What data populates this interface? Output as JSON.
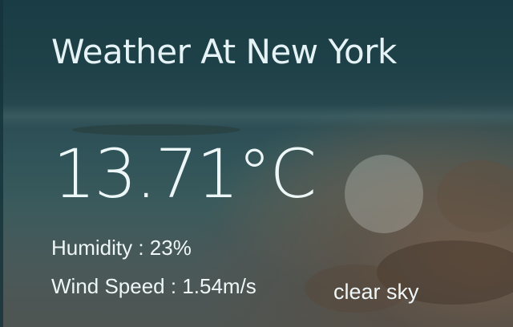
{
  "weather": {
    "title": "Weather At New York",
    "temperature": "13.71°C",
    "humidity": "Humidity : 23%",
    "wind_speed": "Wind Speed : 1.54m/s",
    "description": "clear sky",
    "icon": "clear-sky-icon"
  }
}
